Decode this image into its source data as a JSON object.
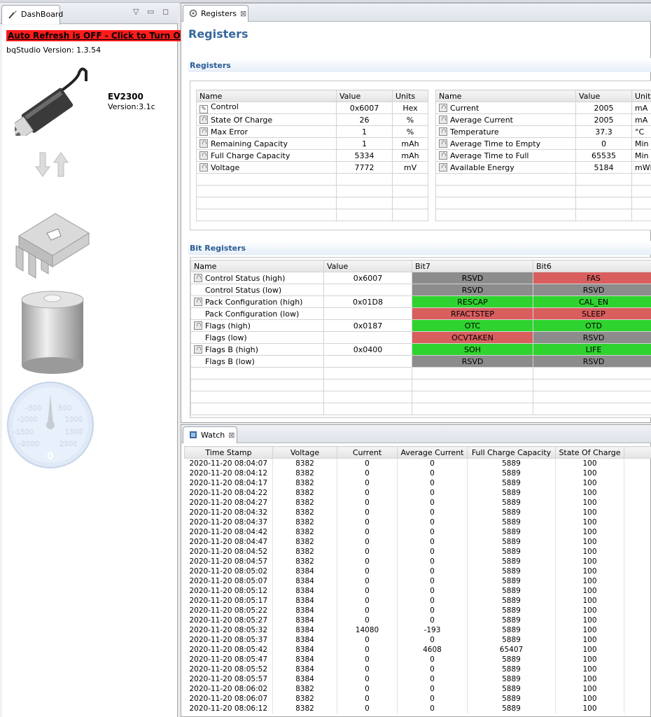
{
  "dashboard": {
    "tab_label": "DashBoard",
    "auto_refresh_text": "Auto Refresh is OFF - Click to Turn On",
    "version_label": "bqStudio Version:",
    "version_value": "1.3.54",
    "device_name": "EV2300",
    "device_version": "Version:3.1c",
    "gauge": {
      "ticks": [
        "-500",
        "500",
        "-1000",
        "1000",
        "-1500",
        "1500",
        "-2000",
        "2000"
      ],
      "value": "0"
    }
  },
  "registers": {
    "tab_label": "Registers",
    "title": "Registers",
    "section_label": "Registers",
    "columns": [
      "Name",
      "Value",
      "Units"
    ],
    "left_rows": [
      {
        "name": "Control",
        "value": "0x6007",
        "units": "Hex",
        "icon": "pencil-icon"
      },
      {
        "name": "State Of Charge",
        "value": "26",
        "units": "%",
        "icon": "lock-icon"
      },
      {
        "name": "Max Error",
        "value": "1",
        "units": "%",
        "icon": "lock-icon"
      },
      {
        "name": "Remaining Capacity",
        "value": "1",
        "units": "mAh",
        "icon": "lock-icon"
      },
      {
        "name": "Full Charge Capacity",
        "value": "5334",
        "units": "mAh",
        "icon": "lock-icon"
      },
      {
        "name": "Voltage",
        "value": "7772",
        "units": "mV",
        "icon": "lock-icon"
      }
    ],
    "right_rows": [
      {
        "name": "Current",
        "value": "2005",
        "units": "mA",
        "icon": "lock-icon"
      },
      {
        "name": "Average Current",
        "value": "2005",
        "units": "mA",
        "icon": "lock-icon"
      },
      {
        "name": "Temperature",
        "value": "37.3",
        "units": "°C",
        "icon": "lock-icon"
      },
      {
        "name": "Average Time to Empty",
        "value": "0",
        "units": "Min",
        "icon": "lock-icon"
      },
      {
        "name": "Average Time to Full",
        "value": "65535",
        "units": "Min",
        "icon": "lock-icon"
      },
      {
        "name": "Available Energy",
        "value": "5184",
        "units": "mWh",
        "icon": "lock-icon"
      }
    ]
  },
  "bit_registers": {
    "section_label": "Bit Registers",
    "columns": [
      "Name",
      "Value",
      "Bit7",
      "Bit6"
    ],
    "colors": {
      "gray": "#8c8c8c",
      "green": "#2fd32f",
      "red": "#d95e5e"
    },
    "rows": [
      {
        "name": "Control Status (high)",
        "value": "0x6007",
        "lock": true,
        "bit7": {
          "label": "RSVD",
          "color": "gray"
        },
        "bit6": {
          "label": "FAS",
          "color": "red"
        }
      },
      {
        "name": "Control Status (low)",
        "value": "",
        "lock": false,
        "bit7": {
          "label": "RSVD",
          "color": "gray"
        },
        "bit6": {
          "label": "RSVD",
          "color": "gray"
        }
      },
      {
        "name": "Pack Configuration (high)",
        "value": "0x01D8",
        "lock": true,
        "bit7": {
          "label": "RESCAP",
          "color": "green"
        },
        "bit6": {
          "label": "CAL_EN",
          "color": "green"
        }
      },
      {
        "name": "Pack Configuration (low)",
        "value": "",
        "lock": false,
        "bit7": {
          "label": "RFACTSTEP",
          "color": "red"
        },
        "bit6": {
          "label": "SLEEP",
          "color": "red"
        }
      },
      {
        "name": "Flags (high)",
        "value": "0x0187",
        "lock": true,
        "bit7": {
          "label": "OTC",
          "color": "green"
        },
        "bit6": {
          "label": "OTD",
          "color": "green"
        }
      },
      {
        "name": "Flags (low)",
        "value": "",
        "lock": false,
        "bit7": {
          "label": "OCVTAKEN",
          "color": "red"
        },
        "bit6": {
          "label": "RSVD",
          "color": "gray"
        }
      },
      {
        "name": "Flags B (high)",
        "value": "0x0400",
        "lock": true,
        "bit7": {
          "label": "SOH",
          "color": "green"
        },
        "bit6": {
          "label": "LIFE",
          "color": "green"
        }
      },
      {
        "name": "Flags B (low)",
        "value": "",
        "lock": false,
        "bit7": {
          "label": "RSVD",
          "color": "gray"
        },
        "bit6": {
          "label": "RSVD",
          "color": "gray"
        }
      }
    ]
  },
  "watch": {
    "tab_label": "Watch",
    "columns": [
      "Time Stamp",
      "Voltage",
      "Current",
      "Average Current",
      "Full Charge Capacity",
      "State Of Charge"
    ],
    "rows": [
      [
        "2020-11-20 08:04:07",
        "8382",
        "0",
        "0",
        "5889",
        "100"
      ],
      [
        "2020-11-20 08:04:12",
        "8382",
        "0",
        "0",
        "5889",
        "100"
      ],
      [
        "2020-11-20 08:04:17",
        "8382",
        "0",
        "0",
        "5889",
        "100"
      ],
      [
        "2020-11-20 08:04:22",
        "8382",
        "0",
        "0",
        "5889",
        "100"
      ],
      [
        "2020-11-20 08:04:27",
        "8382",
        "0",
        "0",
        "5889",
        "100"
      ],
      [
        "2020-11-20 08:04:32",
        "8382",
        "0",
        "0",
        "5889",
        "100"
      ],
      [
        "2020-11-20 08:04:37",
        "8382",
        "0",
        "0",
        "5889",
        "100"
      ],
      [
        "2020-11-20 08:04:42",
        "8382",
        "0",
        "0",
        "5889",
        "100"
      ],
      [
        "2020-11-20 08:04:47",
        "8382",
        "0",
        "0",
        "5889",
        "100"
      ],
      [
        "2020-11-20 08:04:52",
        "8382",
        "0",
        "0",
        "5889",
        "100"
      ],
      [
        "2020-11-20 08:04:57",
        "8382",
        "0",
        "0",
        "5889",
        "100"
      ],
      [
        "2020-11-20 08:05:02",
        "8384",
        "0",
        "0",
        "5889",
        "100"
      ],
      [
        "2020-11-20 08:05:07",
        "8384",
        "0",
        "0",
        "5889",
        "100"
      ],
      [
        "2020-11-20 08:05:12",
        "8384",
        "0",
        "0",
        "5889",
        "100"
      ],
      [
        "2020-11-20 08:05:17",
        "8384",
        "0",
        "0",
        "5889",
        "100"
      ],
      [
        "2020-11-20 08:05:22",
        "8384",
        "0",
        "0",
        "5889",
        "100"
      ],
      [
        "2020-11-20 08:05:27",
        "8384",
        "0",
        "0",
        "5889",
        "100"
      ],
      [
        "2020-11-20 08:05:32",
        "8384",
        "14080",
        "-193",
        "5889",
        "100"
      ],
      [
        "2020-11-20 08:05:37",
        "8384",
        "0",
        "0",
        "5889",
        "100"
      ],
      [
        "2020-11-20 08:05:42",
        "8384",
        "0",
        "4608",
        "65407",
        "100"
      ],
      [
        "2020-11-20 08:05:47",
        "8384",
        "0",
        "0",
        "5889",
        "100"
      ],
      [
        "2020-11-20 08:05:52",
        "8384",
        "0",
        "0",
        "5889",
        "100"
      ],
      [
        "2020-11-20 08:05:57",
        "8384",
        "0",
        "0",
        "5889",
        "100"
      ],
      [
        "2020-11-20 08:06:02",
        "8382",
        "0",
        "0",
        "5889",
        "100"
      ],
      [
        "2020-11-20 08:06:07",
        "8382",
        "0",
        "0",
        "5889",
        "100"
      ],
      [
        "2020-11-20 08:06:12",
        "8382",
        "0",
        "0",
        "5889",
        "100"
      ]
    ]
  }
}
